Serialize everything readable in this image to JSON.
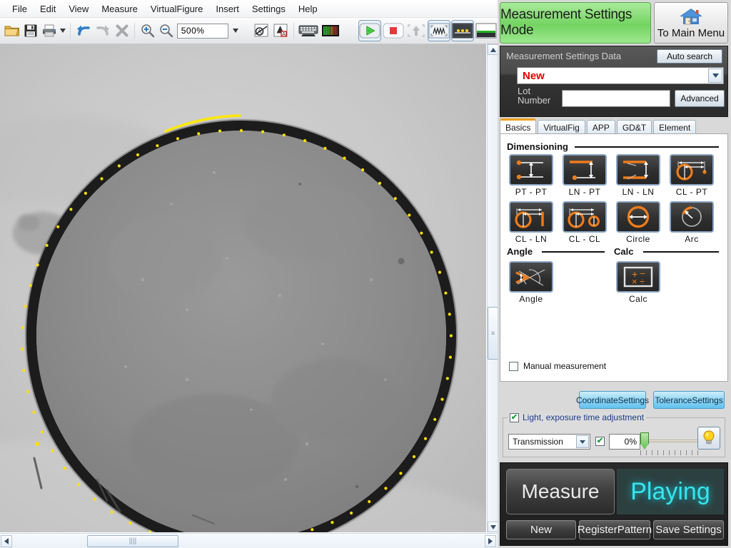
{
  "menu": {
    "items": [
      {
        "label": "File"
      },
      {
        "label": "Edit"
      },
      {
        "label": "View"
      },
      {
        "label": "Measure"
      },
      {
        "label": "VirtualFigure"
      },
      {
        "label": "Insert"
      },
      {
        "label": "Settings"
      },
      {
        "label": "Help"
      }
    ]
  },
  "toolbar": {
    "open_icon": "open-folder-icon",
    "save_icon": "save-floppy-icon",
    "print_icon": "print-icon",
    "print_dropdown_icon": "chevron-down-icon",
    "undo_icon": "undo-arrow-icon",
    "redo_icon": "redo-arrow-icon",
    "delete_icon": "delete-x-icon",
    "zoom_in_icon": "zoom-in-icon",
    "zoom_out_icon": "zoom-out-icon",
    "zoom_value": "500%",
    "zoom_dropdown_icon": "chevron-down-icon",
    "annotation_icon": "annotation-circle-a-icon",
    "text_tool_icon": "text-tool-a-icon",
    "keyboard_icon": "keyboard-icon",
    "barcode_icon": "barcode-icon",
    "play_icon": "play-triangle-icon",
    "stop_icon": "stop-square-icon",
    "focus_icon": "focus-up-arrow-icon",
    "waveform_icon": "waveform-capture-icon",
    "edge_icon": "edge-detect-icon",
    "profile_icon": "profile-level-icon"
  },
  "viewport": {
    "hscroll": {
      "left_arrow_icon": "chevron-left-icon",
      "right_arrow_icon": "chevron-right-icon",
      "grip": "||||"
    },
    "vscroll": {
      "up_arrow_icon": "chevron-up-icon",
      "down_arrow_icon": "chevron-down-icon",
      "grip": "≡"
    }
  },
  "panel": {
    "mode_title": "Measurement Settings Mode",
    "home_button": {
      "label": "To Main Menu",
      "icon": "home-house-icon"
    },
    "settings_data": {
      "title": "Measurement Settings Data",
      "auto_search_label": "Auto search",
      "selected_value": "New",
      "dropdown_icon": "chevron-down-icon",
      "lot_label": "Lot\nNumber",
      "lot_label_line1": "Lot",
      "lot_label_line2": "Number",
      "lot_value": "",
      "lot_placeholder": "",
      "advanced_label": "Advanced"
    },
    "tabs": [
      {
        "label": "Basics",
        "active": true
      },
      {
        "label": "VirtualFig",
        "active": false
      },
      {
        "label": "APP",
        "active": false
      },
      {
        "label": "GD&T",
        "active": false
      },
      {
        "label": "Element",
        "active": false
      }
    ],
    "dimensioning": {
      "title": "Dimensioning",
      "buttons": [
        {
          "label": "PT - PT",
          "icon": "point-to-point-icon"
        },
        {
          "label": "LN - PT",
          "icon": "line-to-point-icon"
        },
        {
          "label": "LN - LN",
          "icon": "line-to-line-icon"
        },
        {
          "label": "CL - PT",
          "icon": "circle-to-point-icon"
        },
        {
          "label": "CL - LN",
          "icon": "circle-to-line-icon"
        },
        {
          "label": "CL - CL",
          "icon": "circle-to-circle-icon"
        },
        {
          "label": "Circle",
          "icon": "circle-diameter-icon"
        },
        {
          "label": "Arc",
          "icon": "arc-radius-icon"
        }
      ]
    },
    "angle": {
      "title": "Angle",
      "button": {
        "label": "Angle",
        "icon": "angle-measure-icon"
      }
    },
    "calc": {
      "title": "Calc",
      "button": {
        "label": "Calc",
        "icon": "calculator-icon"
      }
    },
    "manual_measurement": {
      "label": "Manual measurement",
      "checked": false
    },
    "coordinate_settings_label": "CoordinateSettings",
    "tolerance_settings_label": "ToleranceSettings",
    "light": {
      "group_label": "Light, exposure time adjustment",
      "group_checked": true,
      "mode_value": "Transmission",
      "mode_dropdown_icon": "chevron-down-icon",
      "enable_checked": true,
      "percent_value": "0%",
      "slider_position": 0,
      "bulb_icon": "light-bulb-icon"
    },
    "bottom": {
      "measure_label": "Measure",
      "status_label": "Playing",
      "new_label": "New",
      "register_pattern_label": "RegisterPattern",
      "save_settings_label": "Save Settings"
    }
  },
  "colors": {
    "mode_green": "#74d462",
    "accent_orange": "#f0a020",
    "new_red": "#e00000",
    "playing_cyan": "#35e6f0",
    "settings_blue": "#8ed4f4",
    "detection_yellow": "#ffe000"
  }
}
